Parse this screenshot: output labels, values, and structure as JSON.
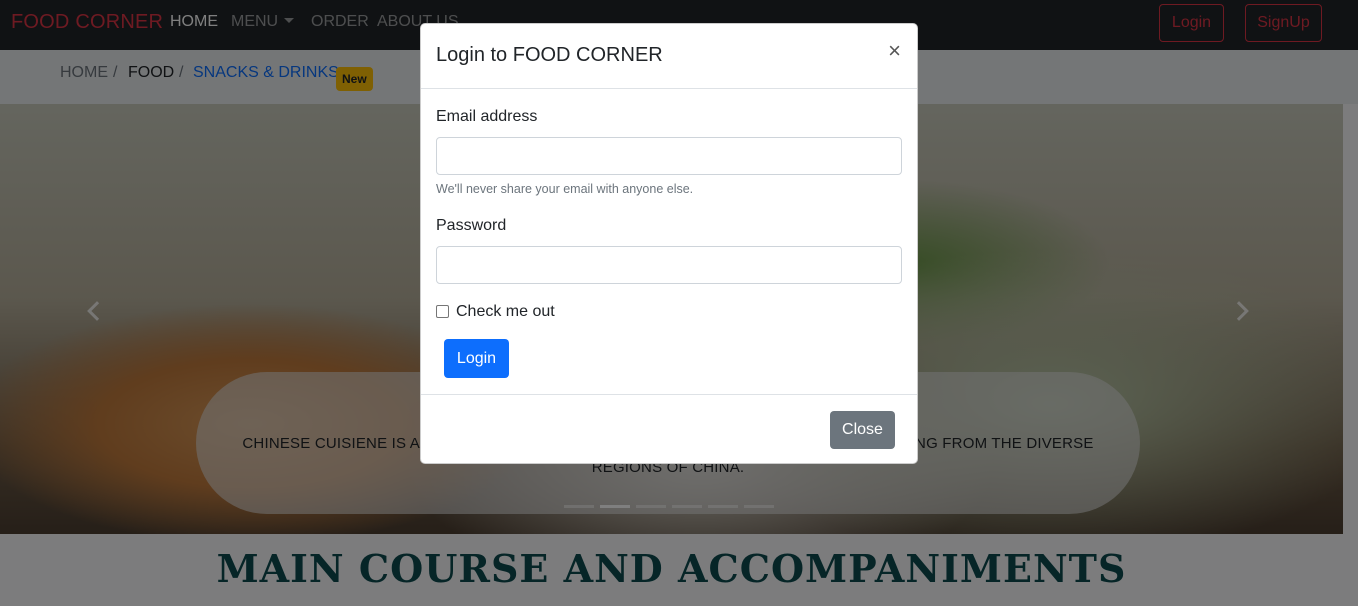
{
  "navbar": {
    "brand": "FOOD CORNER",
    "links": [
      "HOME",
      "MENU",
      "ORDER",
      "ABOUT US"
    ],
    "login_label": "Login",
    "signup_label": "SignUp"
  },
  "breadcrumb": {
    "items": [
      "HOME",
      "FOOD",
      "SNACKS & DRINKS"
    ],
    "badge": "New"
  },
  "carousel": {
    "caption_line1": "CHINESE CUISIENE IS AN IM",
    "caption_line1_end": "NATING FROM THE DIVERSE",
    "caption_line2": "REGIONS OF CHINA.",
    "indicator_count": 6,
    "active_index": 1
  },
  "main": {
    "heading": "MAIN COURSE AND ACCOMPANIMENTS"
  },
  "modal": {
    "title": "Login to FOOD CORNER",
    "close_symbol": "×",
    "email_label": "Email address",
    "email_value": "",
    "email_help": "We'll never share your email with anyone else.",
    "password_label": "Password",
    "password_value": "",
    "checkbox_label": "Check me out",
    "checkbox_checked": false,
    "submit_label": "Login",
    "close_label": "Close"
  },
  "colors": {
    "brand": "#dc3545",
    "primary": "#0d6efd",
    "secondary": "#6c757d",
    "badge": "#ffc107",
    "heading": "#0c4a4f"
  }
}
